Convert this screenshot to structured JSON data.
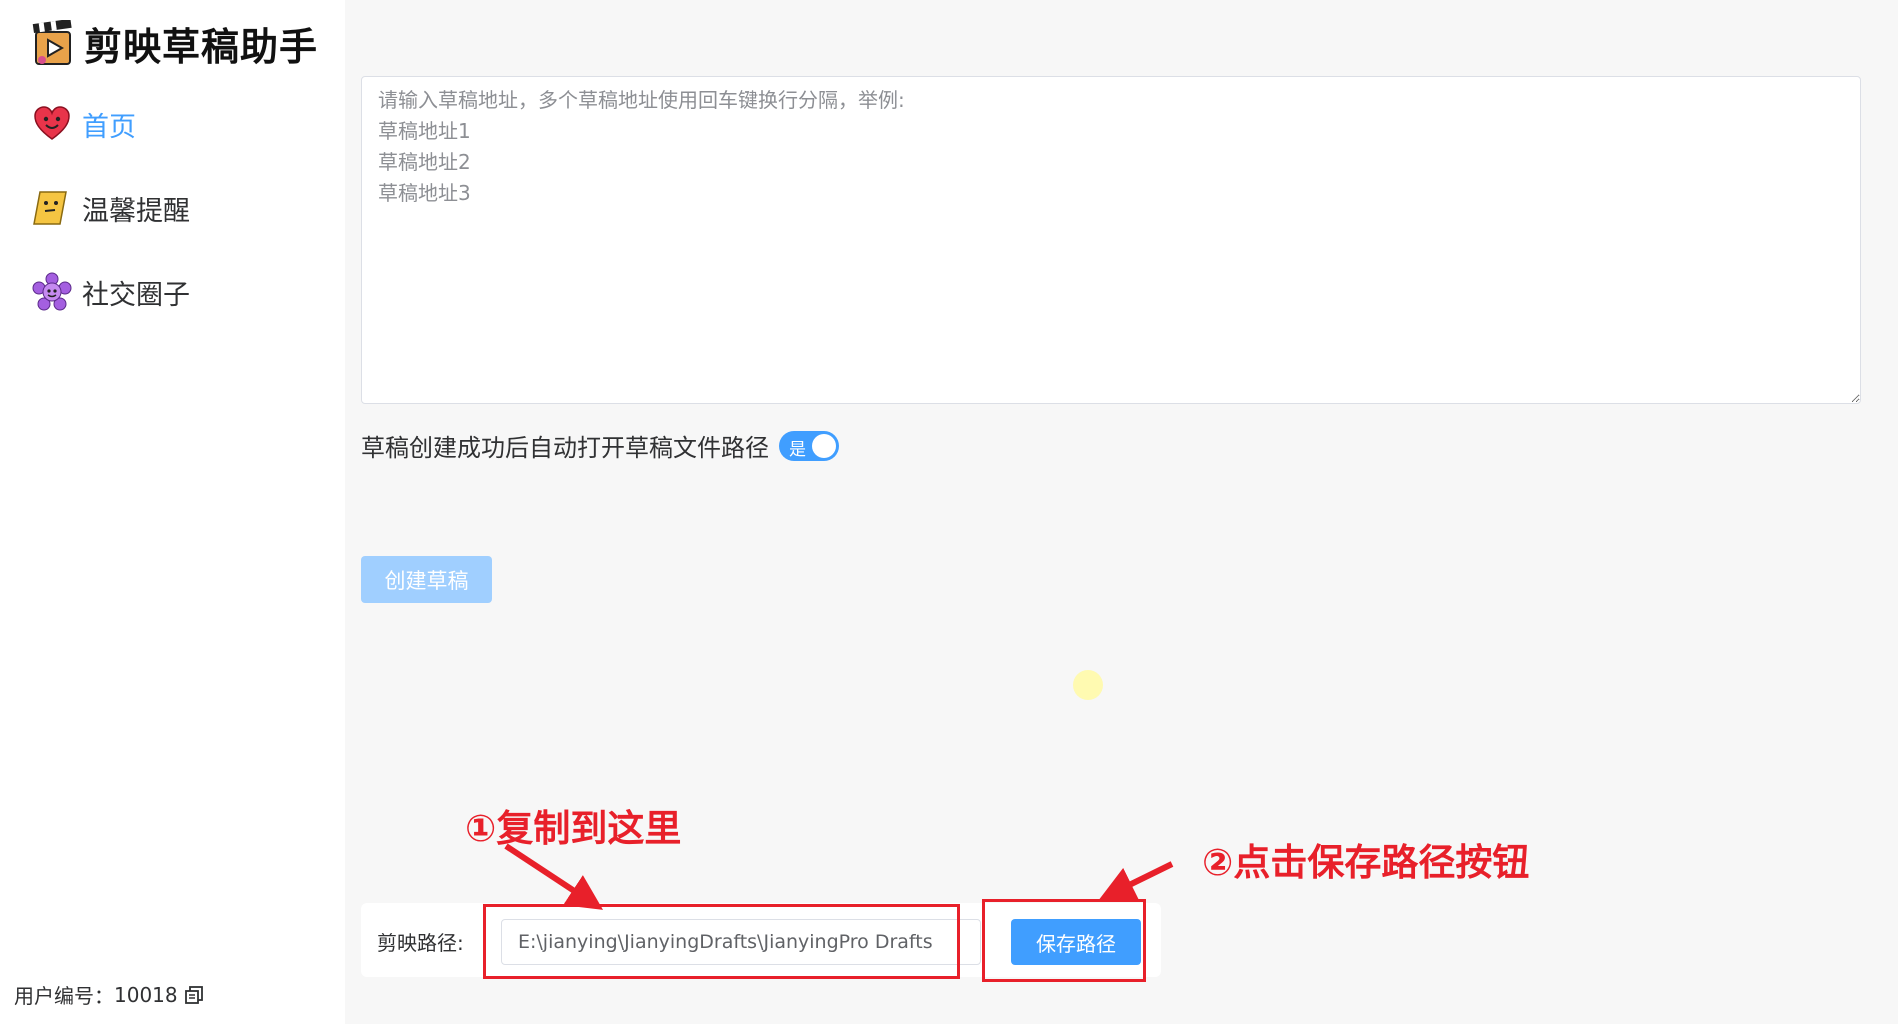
{
  "app": {
    "title": "剪映草稿助手",
    "user_id_label": "用户编号：",
    "user_id": "10018"
  },
  "sidebar": {
    "items": [
      {
        "label": "首页",
        "icon": "heart-face-icon",
        "active": true
      },
      {
        "label": "温馨提醒",
        "icon": "note-face-icon",
        "active": false
      },
      {
        "label": "社交圈子",
        "icon": "flower-face-icon",
        "active": false
      }
    ]
  },
  "main": {
    "drafts_placeholder": "请输入草稿地址，多个草稿地址使用回车键换行分隔，举例:\n草稿地址1\n草稿地址2\n草稿地址3",
    "auto_open_label": "草稿创建成功后自动打开草稿文件路径",
    "auto_open_switch_text": "是",
    "auto_open_enabled": true,
    "create_button": "创建草稿",
    "path_label": "剪映路径:",
    "path_value": "E:\\jianying\\JianyingDrafts\\JianyingPro Drafts",
    "save_button": "保存路径"
  },
  "annotations": {
    "step1": "①复制到这里",
    "step2": "②点击保存路径按钮",
    "color": "#e8202a"
  },
  "colors": {
    "accent": "#409eff",
    "accent_disabled": "#a0cfff"
  }
}
